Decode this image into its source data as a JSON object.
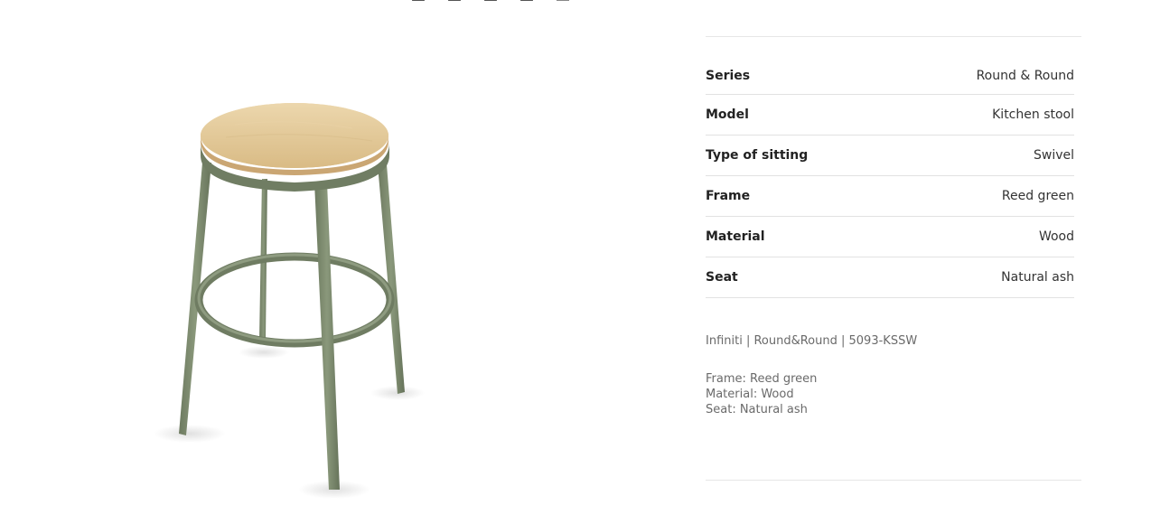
{
  "gallery": {
    "thumbnails": [
      "thumb-1",
      "thumb-2",
      "thumb-3",
      "thumb-4",
      "thumb-5"
    ],
    "product_image": {
      "frame_color": "#7c8a6e",
      "frame_shadow": "#5f6b53",
      "seat_color": "#e3c99a",
      "seat_edge": "#c9a46d"
    }
  },
  "specs": {
    "rows": [
      {
        "key": "Series",
        "value": "Round & Round"
      },
      {
        "key": "Model",
        "value": "Kitchen stool"
      },
      {
        "key": "Type of sitting",
        "value": "Swivel"
      },
      {
        "key": "Frame",
        "value": "Reed green"
      },
      {
        "key": "Material",
        "value": "Wood"
      },
      {
        "key": "Seat",
        "value": "Natural ash"
      }
    ],
    "sku_line": "Infiniti | Round&Round | 5093-KSSW",
    "summary": [
      "Frame: Reed green",
      "Material: Wood",
      "Seat: Natural ash"
    ]
  }
}
